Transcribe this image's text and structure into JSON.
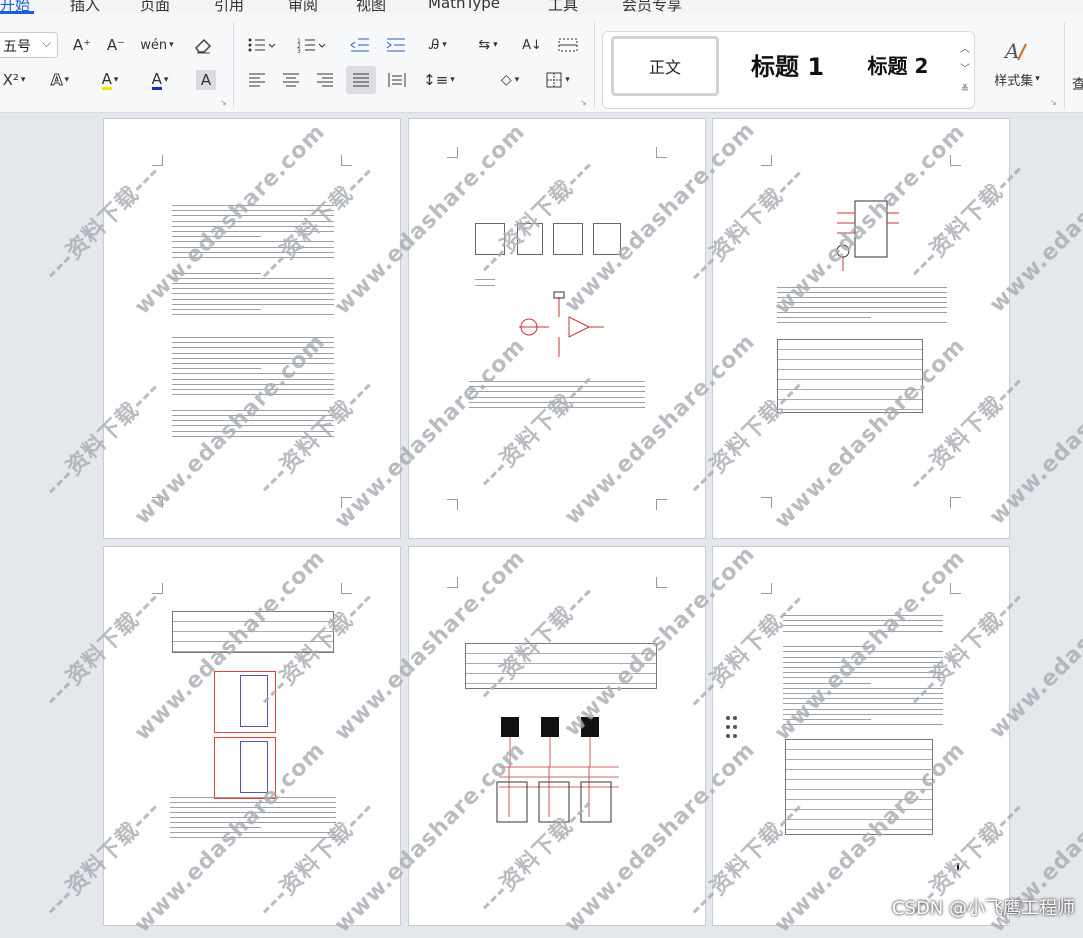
{
  "menubar": {
    "tabs": [
      "开始",
      "插入",
      "页面",
      "引用",
      "审阅",
      "视图",
      "MathType",
      "工具",
      "会员专享"
    ]
  },
  "ribbon": {
    "font_size_value": "五号",
    "grow_font": "A⁺",
    "shrink_font": "A⁻",
    "pinyin_guide": "wén",
    "superscript": "X²",
    "highlight_label": "A",
    "font_color_label": "A",
    "char_shading_label": "A",
    "styles": {
      "normal": "正文",
      "heading1": "标题 1",
      "heading2": "标题 2"
    },
    "style_set_label": "样式集"
  },
  "watermark": {
    "text": "---资料下载---",
    "url_text": "www.edashare.com"
  },
  "footer_watermark": "CSDN @小飞鹰工程师",
  "colors": {
    "accent": "#1a5fd8",
    "background": "#e4e7ec",
    "watermark": "#a8acb2"
  }
}
